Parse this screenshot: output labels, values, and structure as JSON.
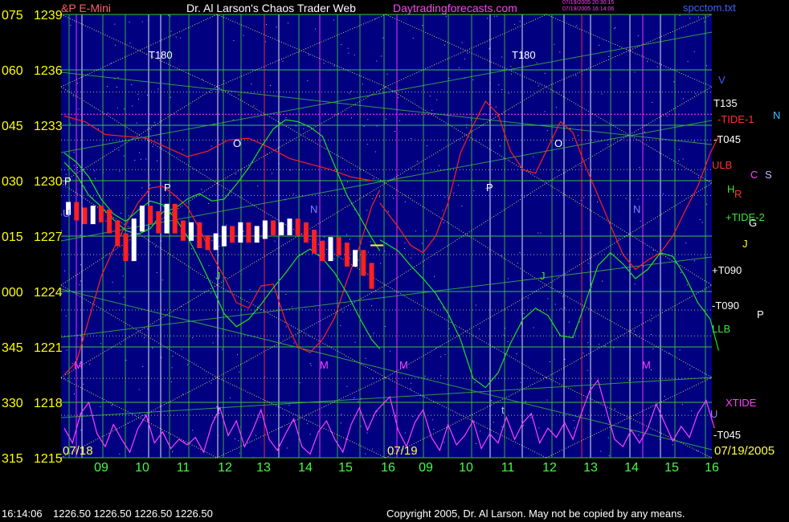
{
  "header": {
    "symbol": "&P E-Mini",
    "title": "Dr. Al Larson's Chaos Trader Web",
    "site": "Daytradingforecasts.com",
    "stamp_line1": "07/19/2005 20:30:15",
    "stamp_line2": "07/19/2005 16:14:06",
    "file": "spcctom.txt"
  },
  "footer": {
    "time": "16:14:06",
    "quote": "1226.50 1226.50 1226.50 1226.50",
    "copyright": "Copyright 2005, Dr. Al Larson. May not be copied by any means."
  },
  "colors": {
    "background": "#000080",
    "price_up": "#ffffff",
    "price_down": "#ff2020",
    "red_curve": "#ff2020",
    "green_curve": "#20e020",
    "magenta_curve": "#ff40ff",
    "yellow_grid": "#ffff60",
    "green_grid": "#40c040",
    "left_labels": "#ffff00"
  },
  "chart_data": {
    "type": "line",
    "title": "S&P E-Mini",
    "ylim": [
      1215,
      1239
    ],
    "y_ticks": [
      {
        "angle": "075",
        "price": "1239"
      },
      {
        "angle": "060",
        "price": "1236"
      },
      {
        "angle": "045",
        "price": "1233"
      },
      {
        "angle": "030",
        "price": "1230"
      },
      {
        "angle": "015",
        "price": "1227"
      },
      {
        "angle": "000",
        "price": "1224"
      },
      {
        "angle": "345",
        "price": "1221"
      },
      {
        "angle": "330",
        "price": "1218"
      },
      {
        "angle": "315",
        "price": "1215"
      }
    ],
    "x_ticks": [
      "09",
      "10",
      "11",
      "12",
      "13",
      "14",
      "15",
      "16",
      "09",
      "10",
      "11",
      "12",
      "13",
      "14",
      "15",
      "16"
    ],
    "date_labels": [
      "07/18",
      "07/19",
      "07/19/2005"
    ],
    "hours": [
      8.5,
      16.2
    ],
    "price_series": {
      "name": "Price 07/18",
      "x": [
        8.6,
        8.8,
        9.0,
        9.2,
        9.4,
        9.6,
        9.8,
        10.0,
        10.2,
        10.4,
        10.6,
        10.8,
        11.0,
        11.2,
        11.4,
        11.6,
        11.8,
        12.0,
        12.2,
        12.4,
        12.6,
        12.8,
        13.0,
        13.2,
        13.4,
        13.6,
        13.8,
        14.0,
        14.2,
        14.4,
        14.6,
        14.8,
        15.0,
        15.2,
        15.4,
        15.6,
        15.8,
        16.0
      ],
      "y": [
        1228.5,
        1228.2,
        1228.0,
        1228.3,
        1228.1,
        1227.5,
        1226.8,
        1226.0,
        1227.6,
        1228.3,
        1228.0,
        1227.5,
        1228.4,
        1227.5,
        1227.1,
        1227.4,
        1226.7,
        1226.6,
        1226.8,
        1227.2,
        1227.0,
        1227.4,
        1227.0,
        1227.2,
        1227.5,
        1227.4,
        1227.4,
        1227.6,
        1227.4,
        1227.0,
        1226.4,
        1226.0,
        1226.6,
        1226.3,
        1225.7,
        1225.9,
        1225.2,
        1224.5
      ]
    },
    "current_price": {
      "x": 16.05,
      "y": 1226.5
    },
    "red_curves": [
      [
        [
          8.5,
          1233.5
        ],
        [
          9.0,
          1233.2
        ],
        [
          9.5,
          1232.5
        ],
        [
          10.0,
          1232.4
        ],
        [
          10.5,
          1232.3
        ],
        [
          11.0,
          1231.8
        ],
        [
          11.5,
          1231.3
        ],
        [
          12.0,
          1231.6
        ],
        [
          12.5,
          1232.2
        ],
        [
          13.0,
          1232.3
        ],
        [
          13.5,
          1231.8
        ],
        [
          14.0,
          1231.2
        ],
        [
          14.5,
          1230.9
        ],
        [
          15.0,
          1230.6
        ],
        [
          15.5,
          1230.2
        ],
        [
          16.0,
          1230.0
        ]
      ],
      [
        [
          8.5,
          1219.5
        ],
        [
          8.8,
          1220.2
        ],
        [
          9.1,
          1222.5
        ],
        [
          9.4,
          1224.8
        ],
        [
          9.7,
          1226.3
        ],
        [
          10.0,
          1227.6
        ],
        [
          10.3,
          1228.8
        ],
        [
          10.6,
          1229.6
        ],
        [
          10.9,
          1229.7
        ],
        [
          11.2,
          1229.2
        ],
        [
          11.5,
          1228.6
        ],
        [
          11.8,
          1227.4
        ],
        [
          12.1,
          1226.0
        ],
        [
          12.4,
          1224.8
        ],
        [
          12.7,
          1223.4
        ],
        [
          13.0,
          1223.1
        ],
        [
          13.3,
          1224.3
        ],
        [
          13.6,
          1224.4
        ],
        [
          13.9,
          1222.4
        ],
        [
          14.2,
          1221.0
        ],
        [
          14.5,
          1220.7
        ],
        [
          14.8,
          1221.4
        ],
        [
          15.1,
          1222.6
        ],
        [
          15.4,
          1224.6
        ],
        [
          15.7,
          1226.4
        ],
        [
          16.0,
          1228.6
        ],
        [
          16.2,
          1229.5
        ]
      ],
      [
        [
          16.2,
          1228.8
        ],
        [
          16.5,
          1227.5
        ],
        [
          16.8,
          1226.5
        ],
        [
          17.1,
          1226.1
        ],
        [
          17.4,
          1227.0
        ],
        [
          17.7,
          1228.8
        ],
        [
          18.0,
          1231.5
        ],
        [
          18.3,
          1233.0
        ],
        [
          18.6,
          1234.3
        ],
        [
          18.9,
          1233.6
        ],
        [
          19.2,
          1231.6
        ],
        [
          19.5,
          1230.6
        ],
        [
          19.8,
          1230.4
        ],
        [
          20.1,
          1231.8
        ],
        [
          20.4,
          1233.2
        ],
        [
          20.7,
          1232.6
        ],
        [
          21.0,
          1230.8
        ],
        [
          21.3,
          1229.2
        ],
        [
          21.6,
          1227.6
        ],
        [
          21.9,
          1226.0
        ],
        [
          22.2,
          1225.2
        ],
        [
          22.5,
          1225.7
        ],
        [
          22.8,
          1226.1
        ],
        [
          23.1,
          1227.0
        ],
        [
          23.4,
          1228.4
        ],
        [
          23.7,
          1229.7
        ],
        [
          24.0,
          1231.5
        ],
        [
          24.2,
          1232.4
        ]
      ]
    ],
    "green_curves": [
      [
        [
          8.5,
          1231.5
        ],
        [
          8.8,
          1231.0
        ],
        [
          9.1,
          1230.2
        ],
        [
          9.4,
          1229.0
        ],
        [
          9.7,
          1228.2
        ],
        [
          10.0,
          1227.8
        ],
        [
          10.3,
          1228.4
        ],
        [
          10.6,
          1228.9
        ],
        [
          10.9,
          1228.7
        ],
        [
          11.2,
          1228.0
        ],
        [
          11.5,
          1227.0
        ],
        [
          11.8,
          1225.7
        ],
        [
          12.1,
          1224.3
        ],
        [
          12.4,
          1222.8
        ],
        [
          12.7,
          1222.1
        ],
        [
          13.0,
          1222.5
        ],
        [
          13.3,
          1223.3
        ],
        [
          13.6,
          1224.2
        ],
        [
          13.9,
          1225.0
        ],
        [
          14.2,
          1225.9
        ],
        [
          14.5,
          1226.3
        ],
        [
          14.8,
          1225.8
        ],
        [
          15.1,
          1225.0
        ],
        [
          15.4,
          1223.9
        ],
        [
          15.7,
          1222.6
        ],
        [
          16.0,
          1221.4
        ],
        [
          16.2,
          1220.9
        ]
      ],
      [
        [
          8.5,
          1231.0
        ],
        [
          8.8,
          1230.3
        ],
        [
          9.1,
          1229.2
        ],
        [
          9.4,
          1228.6
        ],
        [
          9.7,
          1227.9
        ],
        [
          10.0,
          1227.3
        ],
        [
          10.3,
          1227.1
        ],
        [
          10.6,
          1227.4
        ],
        [
          10.9,
          1228.3
        ],
        [
          11.2,
          1228.5
        ],
        [
          11.5,
          1229.0
        ],
        [
          11.8,
          1229.3
        ],
        [
          12.1,
          1228.9
        ],
        [
          12.4,
          1229.0
        ],
        [
          12.7,
          1229.8
        ],
        [
          13.0,
          1230.7
        ],
        [
          13.3,
          1231.8
        ],
        [
          13.6,
          1232.8
        ],
        [
          13.9,
          1233.3
        ],
        [
          14.2,
          1233.2
        ],
        [
          14.5,
          1232.9
        ],
        [
          14.8,
          1232.4
        ],
        [
          15.1,
          1230.8
        ],
        [
          15.4,
          1229.2
        ],
        [
          15.7,
          1228.1
        ],
        [
          16.0,
          1226.9
        ],
        [
          16.2,
          1226.2
        ]
      ],
      [
        [
          16.2,
          1226.8
        ],
        [
          16.5,
          1226.2
        ],
        [
          16.8,
          1225.4
        ],
        [
          17.1,
          1224.7
        ],
        [
          17.4,
          1223.9
        ],
        [
          17.7,
          1222.8
        ],
        [
          18.0,
          1221.4
        ],
        [
          18.3,
          1219.3
        ],
        [
          18.6,
          1218.8
        ],
        [
          18.9,
          1219.6
        ],
        [
          19.2,
          1221.2
        ],
        [
          19.5,
          1222.5
        ],
        [
          19.8,
          1223.1
        ],
        [
          20.1,
          1222.7
        ],
        [
          20.4,
          1221.6
        ],
        [
          20.7,
          1221.5
        ],
        [
          21.0,
          1223.4
        ],
        [
          21.3,
          1225.4
        ],
        [
          21.6,
          1226.1
        ],
        [
          21.9,
          1225.5
        ],
        [
          22.2,
          1224.7
        ],
        [
          22.5,
          1225.2
        ],
        [
          22.8,
          1226.1
        ],
        [
          23.1,
          1225.9
        ],
        [
          23.4,
          1224.8
        ],
        [
          23.7,
          1223.4
        ],
        [
          24.0,
          1222.5
        ],
        [
          24.2,
          1220.8
        ]
      ]
    ],
    "magenta_curve": [
      [
        8.5,
        1216.6
      ],
      [
        8.7,
        1215.8
      ],
      [
        8.9,
        1217.4
      ],
      [
        9.1,
        1218.0
      ],
      [
        9.3,
        1216.3
      ],
      [
        9.5,
        1215.6
      ],
      [
        9.7,
        1216.8
      ],
      [
        9.9,
        1216.0
      ],
      [
        10.1,
        1215.3
      ],
      [
        10.3,
        1216.6
      ],
      [
        10.5,
        1217.3
      ],
      [
        10.7,
        1215.8
      ],
      [
        10.9,
        1216.4
      ],
      [
        11.1,
        1215.5
      ],
      [
        11.3,
        1216.0
      ],
      [
        11.5,
        1215.7
      ],
      [
        11.7,
        1216.1
      ],
      [
        11.9,
        1215.3
      ],
      [
        12.1,
        1216.8
      ],
      [
        12.3,
        1217.7
      ],
      [
        12.5,
        1216.2
      ],
      [
        12.7,
        1217.0
      ],
      [
        12.9,
        1215.6
      ],
      [
        13.1,
        1216.5
      ],
      [
        13.3,
        1217.6
      ],
      [
        13.5,
        1216.0
      ],
      [
        13.7,
        1215.4
      ],
      [
        13.9,
        1216.3
      ],
      [
        14.1,
        1217.1
      ],
      [
        14.3,
        1215.6
      ],
      [
        14.5,
        1215.2
      ],
      [
        14.7,
        1216.4
      ],
      [
        14.9,
        1217.0
      ],
      [
        15.1,
        1216.0
      ],
      [
        15.3,
        1215.3
      ],
      [
        15.5,
        1216.8
      ],
      [
        15.7,
        1217.7
      ],
      [
        15.9,
        1216.5
      ],
      [
        16.1,
        1217.5
      ],
      [
        16.3,
        1218.3
      ],
      [
        16.5,
        1216.5
      ],
      [
        16.7,
        1215.6
      ],
      [
        16.9,
        1216.9
      ],
      [
        17.1,
        1217.6
      ],
      [
        17.3,
        1216.1
      ],
      [
        17.5,
        1215.4
      ],
      [
        17.7,
        1216.8
      ],
      [
        17.9,
        1215.7
      ],
      [
        18.1,
        1216.2
      ],
      [
        18.3,
        1217.0
      ],
      [
        18.5,
        1215.5
      ],
      [
        18.7,
        1216.3
      ],
      [
        18.9,
        1215.8
      ],
      [
        19.1,
        1217.2
      ],
      [
        19.3,
        1216.0
      ],
      [
        19.5,
        1216.9
      ],
      [
        19.7,
        1217.4
      ],
      [
        19.9,
        1215.8
      ],
      [
        20.1,
        1216.6
      ],
      [
        20.3,
        1216.1
      ],
      [
        20.5,
        1216.9
      ],
      [
        20.7,
        1216.0
      ],
      [
        20.9,
        1217.4
      ],
      [
        21.1,
        1218.6
      ],
      [
        21.3,
        1219.2
      ],
      [
        21.5,
        1217.6
      ],
      [
        21.7,
        1216.0
      ],
      [
        21.9,
        1215.6
      ],
      [
        22.1,
        1216.5
      ],
      [
        22.3,
        1215.8
      ],
      [
        22.5,
        1216.6
      ],
      [
        22.7,
        1217.9
      ],
      [
        22.9,
        1216.9
      ],
      [
        23.1,
        1215.9
      ],
      [
        23.3,
        1216.7
      ],
      [
        23.5,
        1216.1
      ],
      [
        23.7,
        1217.4
      ],
      [
        23.9,
        1218.1
      ],
      [
        24.1,
        1216.6
      ]
    ],
    "labels": [
      "T180",
      "T180",
      "O",
      "O",
      "P",
      "P",
      "N",
      "N",
      "M",
      "M",
      "M",
      "M",
      "J",
      "J",
      "U",
      "U",
      "V",
      "C",
      "S",
      "H",
      "R",
      "G",
      "P",
      "t",
      "t"
    ],
    "right_labels": [
      {
        "text": "T135",
        "color": "#ffffff"
      },
      {
        "text": "-TIDE-1",
        "color": "#ff3030"
      },
      {
        "text": "-T045",
        "color": "#ffffff"
      },
      {
        "text": "ULB",
        "color": "#ff3030"
      },
      {
        "text": "+TIDE-2",
        "color": "#40e040"
      },
      {
        "text": "+T090",
        "color": "#ffffff"
      },
      {
        "text": "-T090",
        "color": "#ffffff"
      },
      {
        "text": "LLB",
        "color": "#40e040"
      },
      {
        "text": "XTIDE",
        "color": "#ff40ff"
      },
      {
        "text": "-T045",
        "color": "#ffffff"
      }
    ],
    "markers": [
      "U",
      "N",
      "J",
      "P",
      "U"
    ]
  }
}
